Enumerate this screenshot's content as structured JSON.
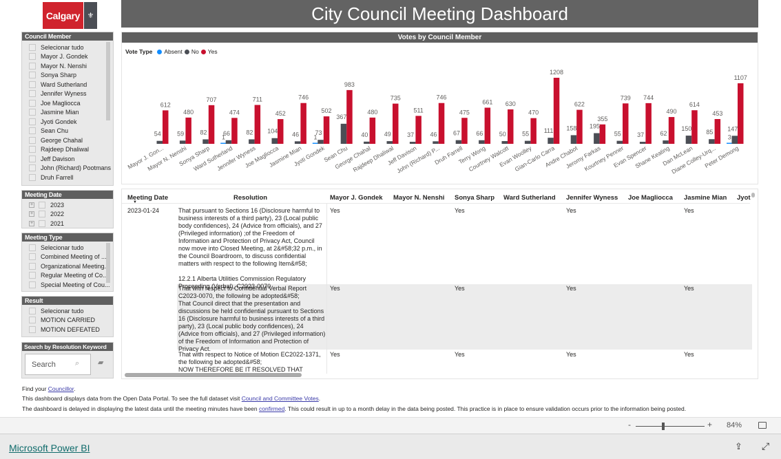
{
  "logo": {
    "text": "Calgary",
    "crest": "city-crest"
  },
  "title": "City Council Meeting Dashboard",
  "filters": {
    "council_member": {
      "label": "Council Member",
      "items": [
        "Selecionar tudo",
        "Mayor J. Gondek",
        "Mayor N. Nenshi",
        "Sonya Sharp",
        "Ward Sutherland",
        "Jennifer Wyness",
        "Joe Magliocca",
        "Jasmine Mian",
        "Jyoti Gondek",
        "Sean Chu",
        "George Chahal",
        "Rajdeep Dhaliwal",
        "Jeff Davison",
        "John (Richard) Pootmans",
        "Druh Farrell"
      ]
    },
    "meeting_date": {
      "label": "Meeting Date",
      "items": [
        "2023",
        "2022",
        "2021"
      ]
    },
    "meeting_type": {
      "label": "Meeting Type",
      "items": [
        "Selecionar tudo",
        "Combined Meeting of ...",
        "Organizational Meeting...",
        "Regular Meeting of Co...",
        "Special Meeting of Cou..."
      ]
    },
    "result": {
      "label": "Result",
      "items": [
        "Selecionar tudo",
        "MOTION CARRIED",
        "MOTION DEFEATED"
      ]
    },
    "search": {
      "label": "Search by Resolution Keyword",
      "placeholder": "Search"
    }
  },
  "chart_data": {
    "type": "bar",
    "title": "Votes by Council Member",
    "legend_title": "Vote Type",
    "legend_placement": "top-left",
    "categories": [
      "Mayor J. Gon...",
      "Mayor N. Nenshi",
      "Sonya Sharp",
      "Ward Sutherland",
      "Jennifer Wyness",
      "Joe Magliocca",
      "Jasmine Mian",
      "Jyoti Gondek",
      "Sean Chu",
      "George Chahal",
      "Rajdeep Dhaliwal",
      "Jeff Davison",
      "John (Richard) P...",
      "Druh Farrell",
      "Terry Wong",
      "Courtney Walcott",
      "Evan Woolley",
      "Gian-Carlo Carra",
      "Andre Chabot",
      "Jeromy Farkas",
      "Kourtney Penner",
      "Evan Spencer",
      "Shane Keating",
      "Dan McLean",
      "Diane Colley-Urq...",
      "Peter Demong"
    ],
    "series": [
      {
        "name": "Absent",
        "color": "#118DFF",
        "values": [
          null,
          null,
          null,
          1,
          null,
          null,
          null,
          1,
          null,
          null,
          null,
          null,
          null,
          null,
          null,
          null,
          null,
          null,
          null,
          null,
          null,
          null,
          null,
          null,
          null,
          3
        ]
      },
      {
        "name": "No",
        "color": "#4B4E55",
        "values": [
          54,
          59,
          82,
          66,
          82,
          104,
          46,
          73,
          367,
          40,
          49,
          37,
          46,
          67,
          66,
          50,
          55,
          111,
          158,
          195,
          55,
          37,
          62,
          150,
          85,
          147
        ]
      },
      {
        "name": "Yes",
        "color": "#C8102E",
        "values": [
          612,
          480,
          707,
          474,
          711,
          452,
          746,
          502,
          983,
          480,
          735,
          511,
          746,
          475,
          661,
          630,
          470,
          1208,
          622,
          355,
          739,
          744,
          490,
          614,
          453,
          1107
        ]
      }
    ],
    "ylim": [
      0,
      1208
    ],
    "grid": false
  },
  "table": {
    "headers": [
      "Meeting Date",
      "Resolution",
      "Mayor J. Gondek",
      "Mayor N. Nenshi",
      "Sonya Sharp",
      "Ward Sutherland",
      "Jennifer Wyness",
      "Joe Magliocca",
      "Jasmine Mian",
      "Jyot"
    ],
    "rows": [
      {
        "date": "2023-01-24",
        "resolution": "That pursuant to Sections 16 (Disclosure harmful to business interests of a third party), 23 (Local public body confidences), 24 (Advice from officials), and 27 (Privileged information) ;of the Freedom of Information and Protection of Privacy Act, Council now move into Closed Meeting, at 2&#58;32 p.m., in the Council Boardroom, to discuss confidential matters with respect to the following Item&#58;\n\n12.2.1 Alberta Utilities Commission Regulatory Proceeding (Verbal), C2023-0070",
        "votes": [
          "Yes",
          "",
          "Yes",
          "",
          "Yes",
          "",
          "Yes"
        ]
      },
      {
        "date": "",
        "resolution": "That with respect to Confidential Verbal Report C2023-0070, the following be adopted&#58;\nThat Council direct that the presentation and discussions be held confidential pursuant to Sections 16 (Disclosure harmful to business interests of a third party), 23 (Local public body confidences), 24 (Advice from officials), and 27 (Privileged information) of the Freedom of Information and Protection of Privacy Act.",
        "votes": [
          "Yes",
          "",
          "Yes",
          "",
          "Yes",
          "",
          "Yes"
        ]
      },
      {
        "date": "",
        "resolution": "That with respect to Notice of Motion EC2022-1371, the following be adopted&#58;\nNOW THEREFORE BE IT RESOLVED THAT COUNCIL",
        "votes": [
          "Yes",
          "",
          "Yes",
          "",
          "Yes",
          "",
          "Yes"
        ]
      }
    ]
  },
  "footer": {
    "line1_prefix": "Find your ",
    "line1_link": "Councillor",
    "line1_suffix": ".",
    "line2_prefix": "This dashboard displays data from the Open Data Portal. To see the full dataset visit ",
    "line2_link": "Council and Committee Votes",
    "line2_suffix": ".",
    "line3_prefix": "The dashboard is delayed in displaying the latest data until the meeting minutes have been ",
    "line3_link": "confirmed",
    "line3_suffix": ". This could result in up to a month delay in the data being posted. This practice is in place to ensure validation occurs prior to the information being posted."
  },
  "zoom": {
    "minus": "-",
    "plus": "+",
    "level": "84%",
    "value_percent": 84
  },
  "brand": "Microsoft Power BI"
}
